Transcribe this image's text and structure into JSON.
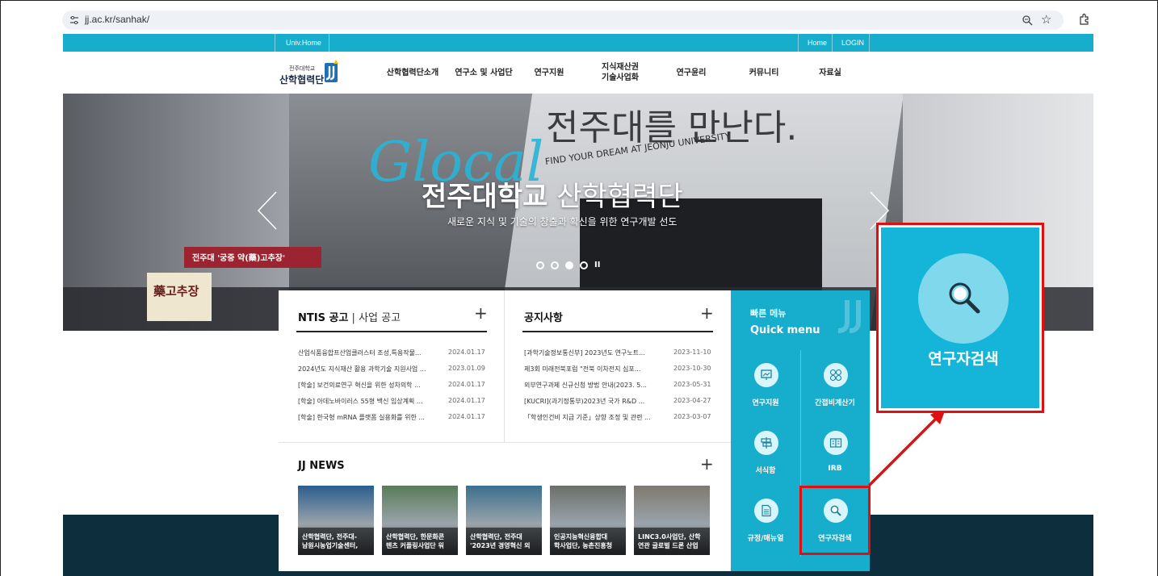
{
  "browser": {
    "url": "jj.ac.kr/sanhak/"
  },
  "topbar": {
    "left_link": "Univ.Home",
    "home": "Home",
    "login": "LOGIN"
  },
  "logo": {
    "small": "전주대학교",
    "big": "산학협력단"
  },
  "nav": {
    "items": [
      "산학협력단소개",
      "연구소 및 사업단",
      "연구지원",
      "지식재산권\n기술사업화",
      "연구윤리",
      "커뮤니티",
      "자료실"
    ]
  },
  "hero": {
    "script_word": "Glocal",
    "title_bold": "전주대학교",
    "title_thin": " 산학협력단",
    "subtitle": "새로운 지식 및 기술의 창출과 확신을 위한 연구개발 선도",
    "wall_text": "전주대를 만난다.",
    "wall_small": "FIND YOUR DREAM AT JEONJU UNIVERSITY",
    "sign_text": "전주대 '궁중 약(藥)고추장'",
    "herb_text": "藥고추장",
    "slides": 4,
    "active_slide": 3
  },
  "ntis": {
    "title": "NTIS 공고",
    "title_sub": "사업 공고",
    "rows": [
      {
        "title": "산업식품융합프산업클러스터 조성,특용작물...",
        "date": "2024.01.17"
      },
      {
        "title": "2024년도 지식재산 활용 과학기술 지원사업 ...",
        "date": "2023.01.09"
      },
      {
        "title": "[학술] 보건의료연구 혁신을 위한 성차의학 ...",
        "date": "2024.01.17"
      },
      {
        "title": "[학술] 아데노바이러스 55형 백신 임상계획 ...",
        "date": "2024.01.17"
      },
      {
        "title": "[학술] 한국형 mRNA 플랫폼 실용화를 위한 ...",
        "date": "2024.01.17"
      }
    ]
  },
  "notice": {
    "title": "공지사항",
    "rows": [
      {
        "title": "[과학기술정보통신부] 2023년도 연구노트...",
        "date": "2023-11-10"
      },
      {
        "title": "제3회 미래전북포럼 \"전북 이차전지 심포...",
        "date": "2023-10-30"
      },
      {
        "title": "외부연구과제 신규신청 방법 안내(2023. 5...",
        "date": "2023-05-31"
      },
      {
        "title": "[KUCRI](과기정통부)2023년 국가 R&D ...",
        "date": "2023-04-27"
      },
      {
        "title": "「학생인건비 지급 기준」상향 조정 및 관련 ...",
        "date": "2023-03-07"
      }
    ]
  },
  "news": {
    "title": "JJ NEWS",
    "items": [
      {
        "caption": "산학협력단, 전주대-\n남원시농업기술센터,",
        "color": "#2c5d8f"
      },
      {
        "caption": "산학협력단, 한문화콘\n텐츠 커플링사업단 워",
        "color": "#5a7c5a"
      },
      {
        "caption": "산학협력단, 전주대\n'2023년 경영혁신 외",
        "color": "#3c6f8e"
      },
      {
        "caption": "인공지능혁신융합대\n학사업단, 농촌진흥청",
        "color": "#6a6f6a"
      },
      {
        "caption": "LINC3.0사업단, 산학\n연관 글로벌 드론 산업",
        "color": "#7e7a70"
      }
    ]
  },
  "quick": {
    "label_ko": "빠른 메뉴",
    "label_en": "Quick menu",
    "items": [
      {
        "label": "연구지원",
        "icon": "presentation-board-icon"
      },
      {
        "label": "간접비계산기",
        "icon": "calculator-icon"
      },
      {
        "label": "서식함",
        "icon": "signpost-icon"
      },
      {
        "label": "IRB",
        "icon": "book-icon"
      },
      {
        "label": "규정/매뉴얼",
        "icon": "document-icon"
      },
      {
        "label": "연구자검색",
        "icon": "search-icon"
      }
    ]
  },
  "callout": {
    "label": "연구자검색",
    "icon": "search-icon"
  },
  "colors": {
    "brand": "#17aecd",
    "band": "#0c2e3d",
    "highlight": "#e01010"
  }
}
